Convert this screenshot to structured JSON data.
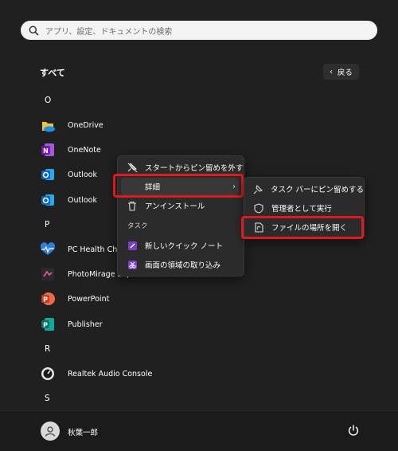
{
  "search": {
    "placeholder": "アプリ、設定、ドキュメントの検索"
  },
  "header": {
    "title": "すべて",
    "back_label": "戻る"
  },
  "letters": {
    "o": "O",
    "p": "P",
    "r": "R",
    "s": "S"
  },
  "apps": {
    "onedrive": "OneDrive",
    "onenote": "OneNote",
    "outlook1": "Outlook",
    "outlook2": "Outlook",
    "pchealth": "PC Health Chec",
    "photomirage": "PhotoMirage Express for HEC",
    "powerpoint": "PowerPoint",
    "publisher": "Publisher",
    "realtek": "Realtek Audio Console"
  },
  "context_menu": {
    "unpin": "スタートからピン留めを外す",
    "details": "詳細",
    "uninstall": "アンインストール",
    "task_group": "タスク",
    "new_quick_note": "新しいクイック ノート",
    "screen_clip": "画面の領域の取り込み"
  },
  "submenu": {
    "pin_taskbar": "タスク バーにピン留めする",
    "run_admin": "管理者として実行",
    "open_location": "ファイルの場所を開く"
  },
  "user": {
    "name": "秋葉一郎"
  },
  "colors": {
    "highlight_border": "#e0191e",
    "menu_bg": "#2b2b2b",
    "start_bg": "#202020"
  }
}
